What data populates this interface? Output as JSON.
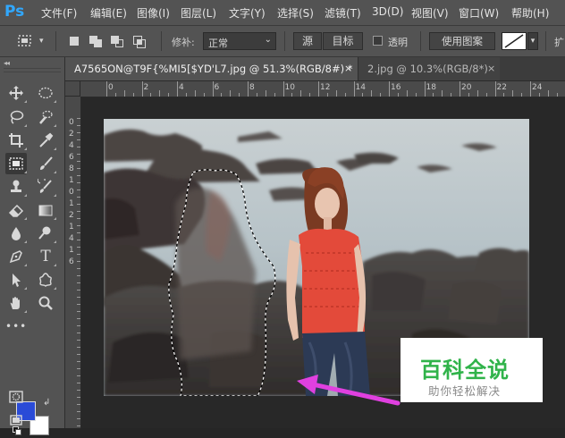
{
  "app": {
    "logo": "Ps"
  },
  "menu": [
    "文件(F)",
    "编辑(E)",
    "图像(I)",
    "图层(L)",
    "文字(Y)",
    "选择(S)",
    "滤镜(T)",
    "3D(D)",
    "视图(V)",
    "窗口(W)",
    "帮助(H)"
  ],
  "options": {
    "feather_label": "修补:",
    "mode_value": "正常",
    "source_label": "源",
    "destination_label": "目标",
    "transparent_label": "透明",
    "use_pattern_label": "使用图案",
    "more_label": "扩"
  },
  "tabs": [
    {
      "label": "A7565ON@T9F{%MI5[$YD'L7.jpg @ 51.3%(RGB/8#) *",
      "close": "×",
      "active": true
    },
    {
      "label": "2.jpg @ 10.3%(RGB/8*)",
      "close": "×",
      "active": false
    }
  ],
  "ruler": {
    "h_labels": [
      "0",
      "2",
      "4",
      "6",
      "8",
      "10",
      "12",
      "14",
      "16",
      "18",
      "20",
      "22",
      "24"
    ],
    "v_labels": [
      "0",
      "2",
      "4",
      "6",
      "8",
      "1",
      "0",
      "1",
      "2",
      "1",
      "4",
      "1",
      "6"
    ]
  },
  "colors": {
    "foreground": "#2a4bd7",
    "background": "#ffffff",
    "accent": "#31a8ff",
    "selection_arrow": "#e040e0",
    "watermark_green": "#30b34a"
  },
  "tools": [
    "move-icon",
    "marquee-ellipse-icon",
    "lasso-icon",
    "quick-select-icon",
    "crop-icon",
    "eyedropper-icon",
    "patch-icon",
    "brush-icon",
    "stamp-icon",
    "history-brush-icon",
    "eraser-icon",
    "gradient-icon",
    "blur-icon",
    "dodge-icon",
    "pen-icon",
    "type-icon",
    "path-select-icon",
    "shape-icon",
    "hand-icon",
    "zoom-icon",
    "more-icon",
    "quick-mask-icon"
  ],
  "watermark": {
    "title": "百科全说",
    "subtitle": "助你轻松解决"
  }
}
